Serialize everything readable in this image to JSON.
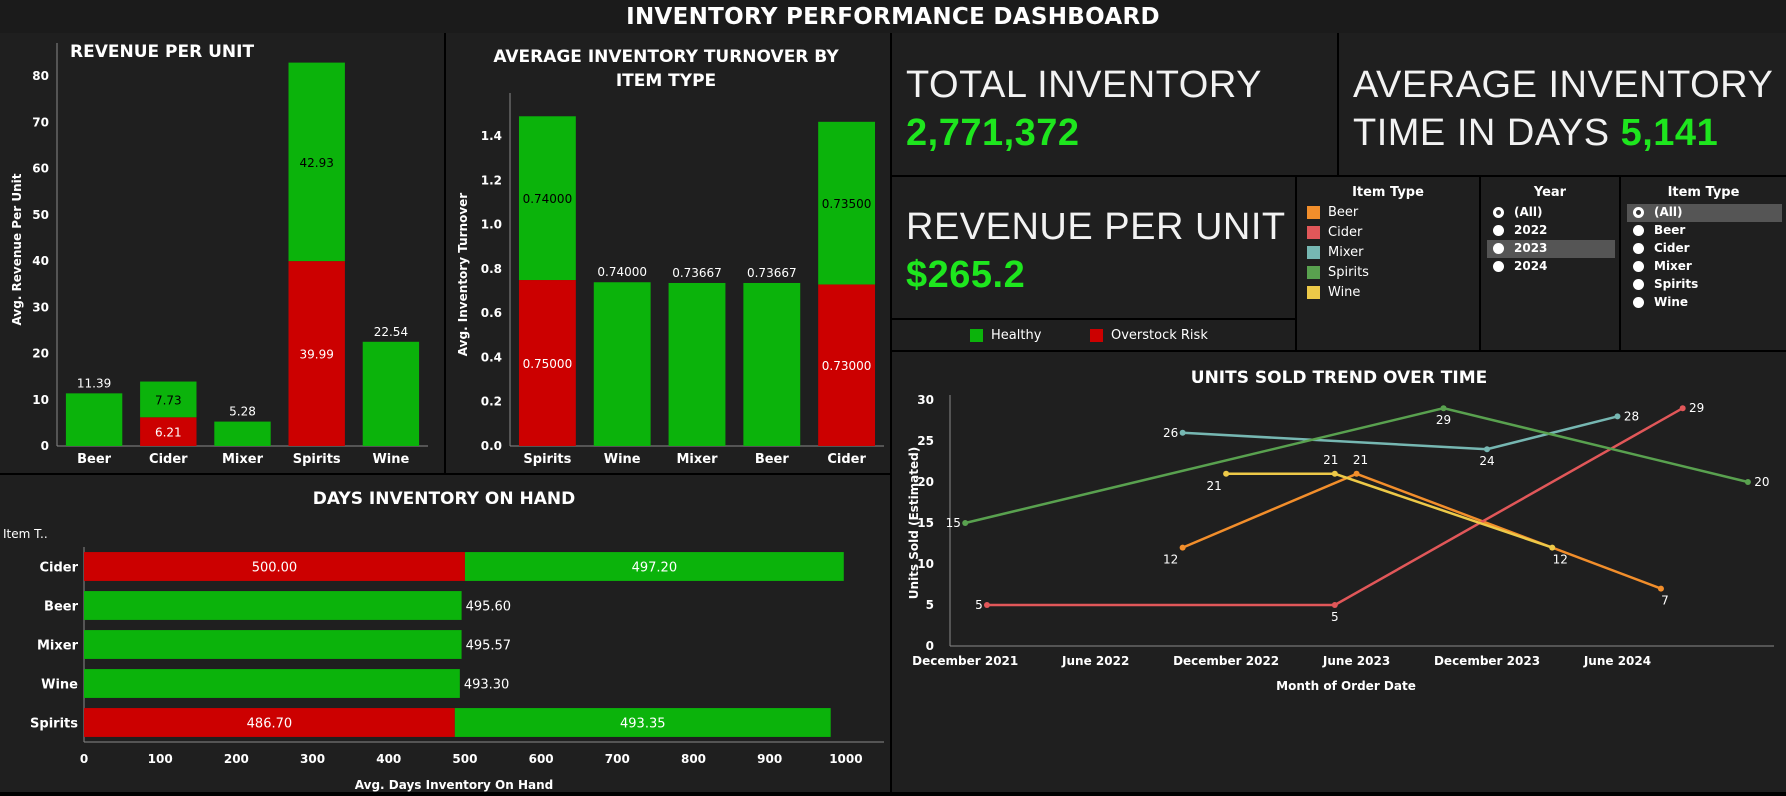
{
  "title": "INVENTORY PERFORMANCE DASHBOARD",
  "colors": {
    "healthy": "#0bb30b",
    "overstock": "#cc0000",
    "kpi": "#1ee61e"
  },
  "kpis": {
    "total_inventory": {
      "label": "TOTAL INVENTORY",
      "value": "2,771,372"
    },
    "avg_time_label_1": "AVERAGE INVENTORY",
    "avg_time_label_2": "TIME IN DAYS",
    "avg_time_value": "5,141",
    "revenue_per_unit": {
      "label": "REVENUE PER UNIT",
      "value": "$265.2"
    }
  },
  "status_legend": {
    "healthy": "Healthy",
    "overstock": "Overstock Risk"
  },
  "filters": {
    "item_type_legend": {
      "title": "Item Type",
      "items": [
        {
          "label": "Beer",
          "color": "#f28e2b"
        },
        {
          "label": "Cider",
          "color": "#e15759"
        },
        {
          "label": "Mixer",
          "color": "#76b7b2"
        },
        {
          "label": "Spirits",
          "color": "#59a14f"
        },
        {
          "label": "Wine",
          "color": "#edc948"
        }
      ]
    },
    "year": {
      "title": "Year",
      "options": [
        "(All)",
        "2022",
        "2023",
        "2024"
      ],
      "selected": "(All)",
      "highlighted": "2023"
    },
    "item_type": {
      "title": "Item Type",
      "options": [
        "(All)",
        "Beer",
        "Cider",
        "Mixer",
        "Spirits",
        "Wine"
      ],
      "selected": "(All)"
    }
  },
  "chart_data": [
    {
      "id": "revenue",
      "type": "bar",
      "stacked": true,
      "title": "REVENUE PER UNIT",
      "ylabel": "Avg. Revenue Per Unit",
      "ylim": [
        0,
        85
      ],
      "yticks": [
        0,
        10,
        20,
        30,
        40,
        50,
        60,
        70,
        80
      ],
      "categories": [
        "Beer",
        "Cider",
        "Mixer",
        "Spirits",
        "Wine"
      ],
      "series": [
        {
          "name": "Overstock Risk",
          "color": "#cc0000",
          "values": [
            0,
            6.21,
            0,
            39.99,
            0
          ],
          "labels": [
            "",
            "6.21",
            "",
            "39.99",
            ""
          ]
        },
        {
          "name": "Healthy",
          "color": "#0bb30b",
          "values": [
            11.39,
            7.73,
            5.28,
            42.93,
            22.54
          ],
          "labels": [
            "11.39",
            "7.73",
            "5.28",
            "42.93",
            "22.54"
          ]
        }
      ]
    },
    {
      "id": "turnover",
      "type": "bar",
      "stacked": true,
      "title": "AVERAGE INVENTORY TURNOVER BY ITEM TYPE",
      "ylabel": "Avg. Inventory Turnover",
      "ylim": [
        0,
        1.55
      ],
      "yticks": [
        "0.0",
        "0.2",
        "0.4",
        "0.6",
        "0.8",
        "1.0",
        "1.2",
        "1.4"
      ],
      "categories": [
        "Spirits",
        "Wine",
        "Mixer",
        "Beer",
        "Cider"
      ],
      "series": [
        {
          "name": "Overstock Risk",
          "color": "#cc0000",
          "values": [
            0.75,
            0,
            0,
            0,
            0.73
          ],
          "labels": [
            "0.75000",
            "",
            "",
            "",
            "0.73000"
          ]
        },
        {
          "name": "Healthy",
          "color": "#0bb30b",
          "values": [
            0.74,
            0.74,
            0.73667,
            0.73667,
            0.735
          ],
          "labels": [
            "0.74000",
            "0.74000",
            "0.73667",
            "0.73667",
            "0.73500"
          ]
        }
      ]
    },
    {
      "id": "days",
      "type": "bar",
      "orientation": "horizontal",
      "stacked": true,
      "title": "DAYS INVENTORY ON HAND",
      "xlabel": "Avg. Days Inventory On Hand",
      "ylabel": "Item T..",
      "xlim": [
        0,
        1050
      ],
      "xticks": [
        0,
        100,
        200,
        300,
        400,
        500,
        600,
        700,
        800,
        900,
        1000
      ],
      "categories": [
        "Cider",
        "Beer",
        "Mixer",
        "Wine",
        "Spirits"
      ],
      "series": [
        {
          "name": "Overstock Risk",
          "color": "#cc0000",
          "values": [
            500.0,
            0,
            0,
            0,
            486.7
          ],
          "labels": [
            "500.00",
            "",
            "",
            "",
            "486.70"
          ]
        },
        {
          "name": "Healthy",
          "color": "#0bb30b",
          "values": [
            497.2,
            495.6,
            495.57,
            493.3,
            493.35
          ],
          "labels": [
            "497.20",
            "495.60",
            "495.57",
            "493.30",
            "493.35"
          ]
        }
      ]
    },
    {
      "id": "units",
      "type": "line",
      "title": "UNITS SOLD TREND OVER TIME",
      "xlabel": "Month of Order Date",
      "ylabel": "Units Sold (Estimated)",
      "ylim": [
        0,
        30
      ],
      "yticks": [
        0,
        5,
        10,
        15,
        20,
        25,
        30
      ],
      "xticks": [
        {
          "label": "December 2021",
          "date": "2021-12"
        },
        {
          "label": "June 2022",
          "date": "2022-06"
        },
        {
          "label": "December 2022",
          "date": "2022-12"
        },
        {
          "label": "June 2023",
          "date": "2023-06"
        },
        {
          "label": "December 2023",
          "date": "2023-12"
        },
        {
          "label": "June 2024",
          "date": "2024-06"
        }
      ],
      "series": [
        {
          "name": "Beer",
          "color": "#f28e2b",
          "points": [
            {
              "x": "2022-10",
              "y": 12
            },
            {
              "x": "2023-06",
              "y": 21
            },
            {
              "x": "2024-08",
              "y": 7
            }
          ]
        },
        {
          "name": "Cider",
          "color": "#e15759",
          "points": [
            {
              "x": "2022-01",
              "y": 5
            },
            {
              "x": "2023-05",
              "y": 5
            },
            {
              "x": "2024-09",
              "y": 29
            }
          ]
        },
        {
          "name": "Mixer",
          "color": "#76b7b2",
          "points": [
            {
              "x": "2022-10",
              "y": 26
            },
            {
              "x": "2023-12",
              "y": 24
            },
            {
              "x": "2024-06",
              "y": 28
            }
          ]
        },
        {
          "name": "Spirits",
          "color": "#59a14f",
          "points": [
            {
              "x": "2021-12",
              "y": 15
            },
            {
              "x": "2023-10",
              "y": 29
            },
            {
              "x": "2024-12",
              "y": 20
            }
          ]
        },
        {
          "name": "Wine",
          "color": "#edc948",
          "points": [
            {
              "x": "2022-12",
              "y": 21
            },
            {
              "x": "2023-05",
              "y": 21
            },
            {
              "x": "2024-03",
              "y": 12
            }
          ]
        }
      ]
    }
  ]
}
